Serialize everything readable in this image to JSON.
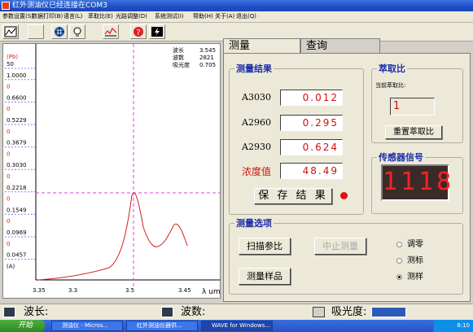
{
  "window": {
    "title": "红外测油仪已经连接在COM3"
  },
  "menu": [
    "参数设置(S)",
    "数据打印(B)",
    "语言(L)",
    "萃取比(E)",
    "光路调整(D)",
    "系统测试(I)",
    "帮助(H)",
    "关于(A)",
    "退出(Q)"
  ],
  "toolbar": {
    "icons": [
      "chart-icon",
      "blank-icon",
      "target-icon",
      "bulb-icon",
      "spectrum-icon",
      "help-icon",
      "lightning-icon"
    ]
  },
  "chart": {
    "y_unit": "(Pb)",
    "y_ticks": [
      "50",
      "1.0000",
      "0",
      "0.6600",
      "0",
      "0.5229",
      "0",
      "0.3679",
      "0",
      "0.3030",
      "0",
      "0.2218",
      "0",
      "0.1549",
      "0",
      "0.0969",
      "0",
      "0.0457",
      "(A)"
    ],
    "x_ticks": [
      "3.35",
      "3.3",
      "3.5",
      "3.45"
    ],
    "x_unit": "λ um",
    "info": [
      {
        "label": "波长",
        "value": "3.545"
      },
      {
        "label": "波数",
        "value": "2821"
      },
      {
        "label": "吸光度",
        "value": "0.705"
      }
    ],
    "accent": "#e040e0"
  },
  "tabs": [
    "测量",
    "查询"
  ],
  "measure": {
    "group_title": "测量结果",
    "rows": [
      {
        "label": "A3030",
        "value": "0.012"
      },
      {
        "label": "A2960",
        "value": "0.295"
      },
      {
        "label": "A2930",
        "value": "0.624"
      }
    ],
    "conc_label": "浓度值",
    "conc_value": "48.49",
    "save_label": "保 存 结 果"
  },
  "extract": {
    "group_title": "萃取比",
    "current_label": "当前萃取比:",
    "value": "1",
    "reset_label": "重置萃取比"
  },
  "sensor": {
    "group_title": "传感器信号",
    "value": "1118"
  },
  "options": {
    "group_title": "测量选项",
    "scan_label": "扫描参比",
    "stop_label": "中止测量",
    "sample_label": "测量样品",
    "radios": [
      {
        "label": "调零",
        "checked": false
      },
      {
        "label": "测标",
        "checked": false
      },
      {
        "label": "测样",
        "checked": true
      }
    ]
  },
  "status": {
    "wavelength": "波长:",
    "wavenumber": "波数:",
    "absorbance": "吸光度:"
  },
  "taskbar": {
    "start": "开始",
    "items": [
      "测油仪 - Micros...",
      "红外测油仪器供...",
      "WAVE for Windows..."
    ],
    "clock": "8:10"
  },
  "colors": {
    "value_red": "#d01010",
    "group_blue": "#1d2eaa",
    "led_red": "#ff2020"
  }
}
